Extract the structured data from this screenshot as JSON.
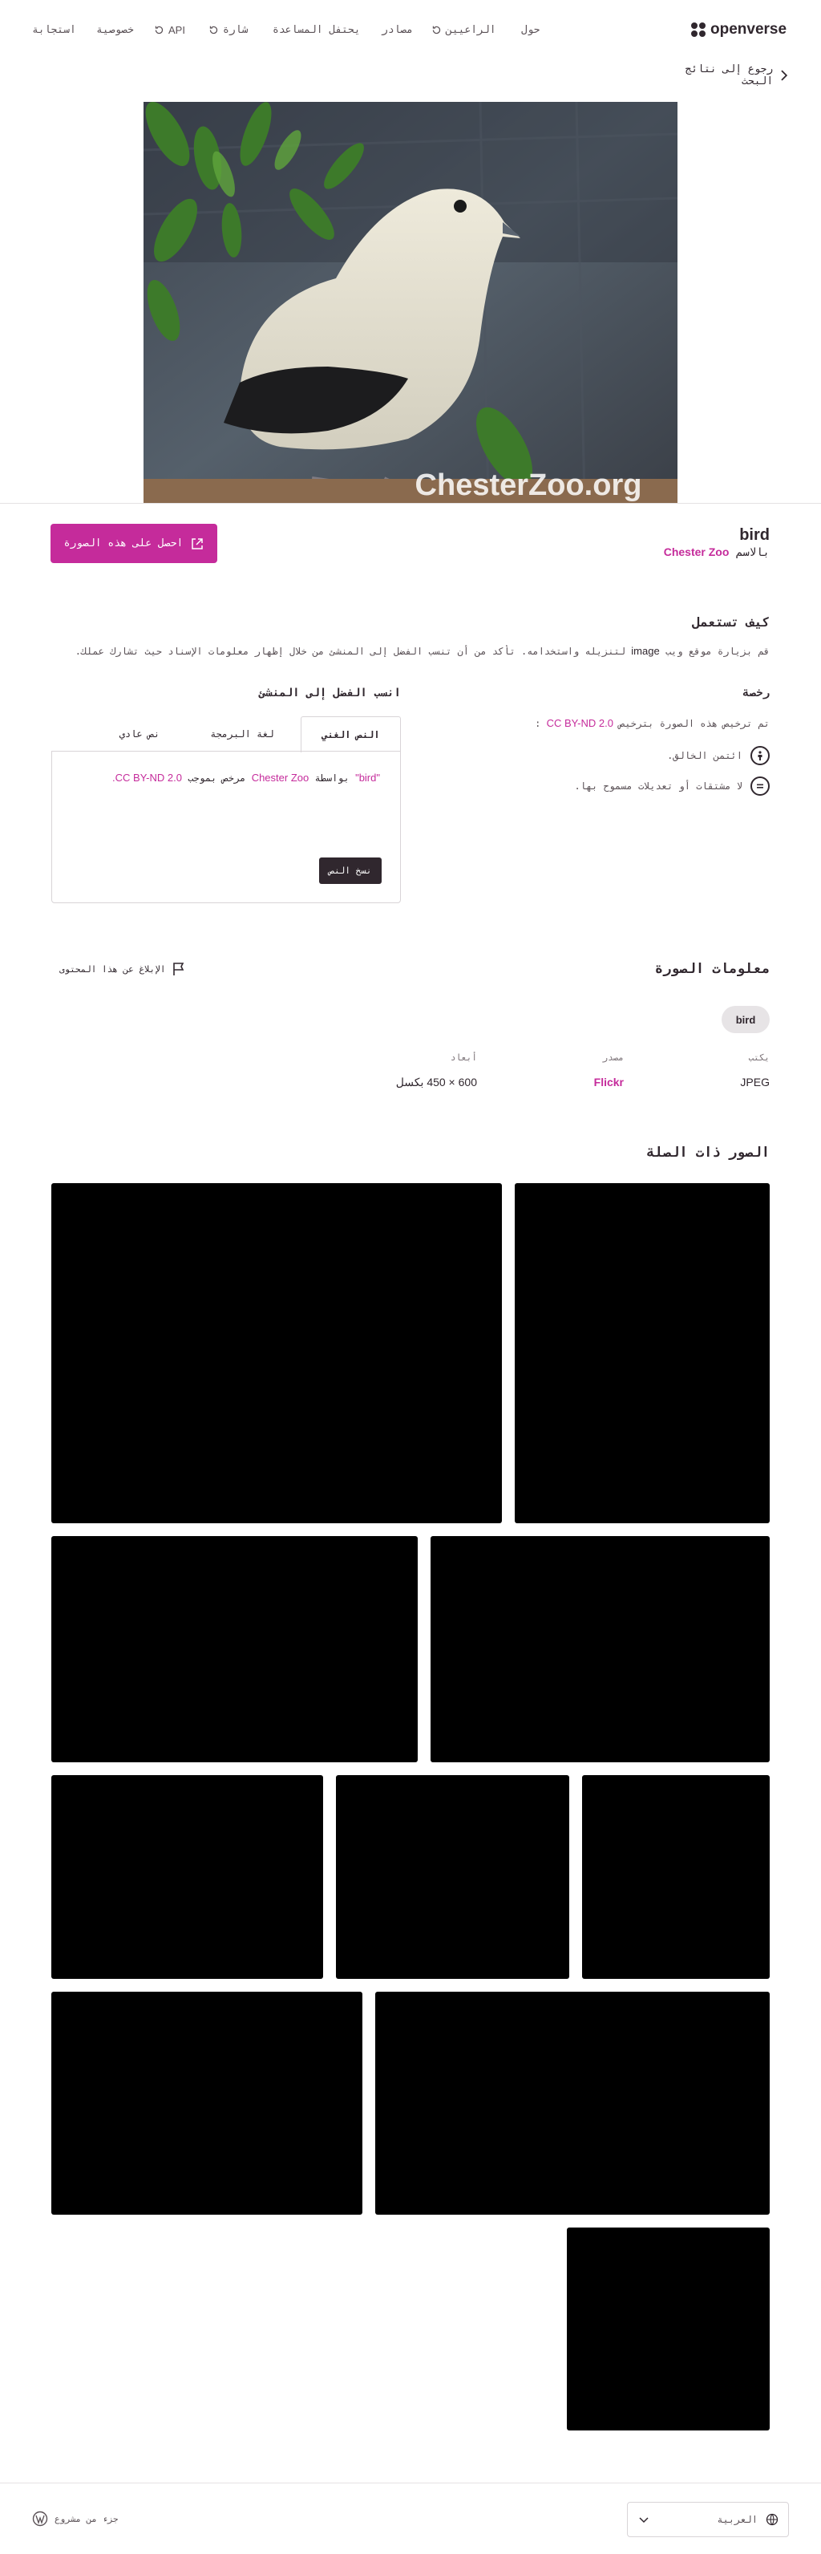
{
  "header": {
    "logo": "openverse",
    "nav": [
      {
        "label": "حول",
        "icon": ""
      },
      {
        "label": "الراعيين",
        "icon": "refresh-icon"
      },
      {
        "label": "مصادر",
        "icon": ""
      },
      {
        "label": "يحتفل المساعدة",
        "icon": ""
      },
      {
        "label": "شارة",
        "icon": "refresh-icon"
      },
      {
        "label": "API",
        "icon": "refresh-icon"
      },
      {
        "label": "خصوصية",
        "icon": ""
      },
      {
        "label": "استجابة",
        "icon": ""
      }
    ]
  },
  "back_link": "رجوع إلى نتائج البحث",
  "image": {
    "title": "bird",
    "by_prefix": "بالاسم",
    "creator": "Chester Zoo",
    "watermark": "ChesterZoo.org"
  },
  "download_button": "احصل على هذه الصورة",
  "how_to_use": {
    "heading": "كيف تستعمل",
    "text_before": "قم بزيارة موقع ويب",
    "text_term": "image",
    "text_after": "لتنزيله واستخدامه. تأكد من أن تنسب الفضل إلى المنشئ من خلال إظهار معلومات الإسناد حيث تشارك عملك."
  },
  "license": {
    "heading": "رخصة",
    "line_prefix": "تم ترخيص هذه الصورة بترخيص",
    "license_name": "CC BY-ND 2.0",
    "line_suffix": ":",
    "items": [
      {
        "icon": "attribution-icon",
        "text": "ائتمن الخالق."
      },
      {
        "icon": "no-derivatives-icon",
        "text": "لا مشتقات أو تعديلات مسموح بها."
      }
    ]
  },
  "attribution": {
    "heading": "انسب الفضل إلى المنشئ",
    "tabs": [
      "النص الغني",
      "لغة البرمجة",
      "نص عادي"
    ],
    "active_tab": 0,
    "quote_title": "\"bird\"",
    "by_word": "بواسطة",
    "creator": "Chester Zoo",
    "licensed_word": "مرخص بموجب",
    "license": "CC BY-ND 2.0.",
    "copy_button": "نسخ النص"
  },
  "image_info": {
    "heading": "معلومات الصورة",
    "report": "الإبلاغ عن هذا المحتوى",
    "tag": "bird",
    "meta": [
      {
        "label": "يكتب",
        "value": "JPEG",
        "link": false
      },
      {
        "label": "مصدر",
        "value": "Flickr",
        "link": true
      },
      {
        "label": "أبعاد",
        "value": "600 × 450 بكسل",
        "link": false
      }
    ]
  },
  "related": {
    "heading": "الصور ذات الصلة",
    "count": 12
  },
  "footer": {
    "language": "العربية",
    "wordpress": "جزء من مشروع"
  },
  "colors": {
    "accent": "#c52b9b",
    "text": "#30272e",
    "button_dark": "#30272e",
    "tag_bg": "#e7e4e6"
  }
}
